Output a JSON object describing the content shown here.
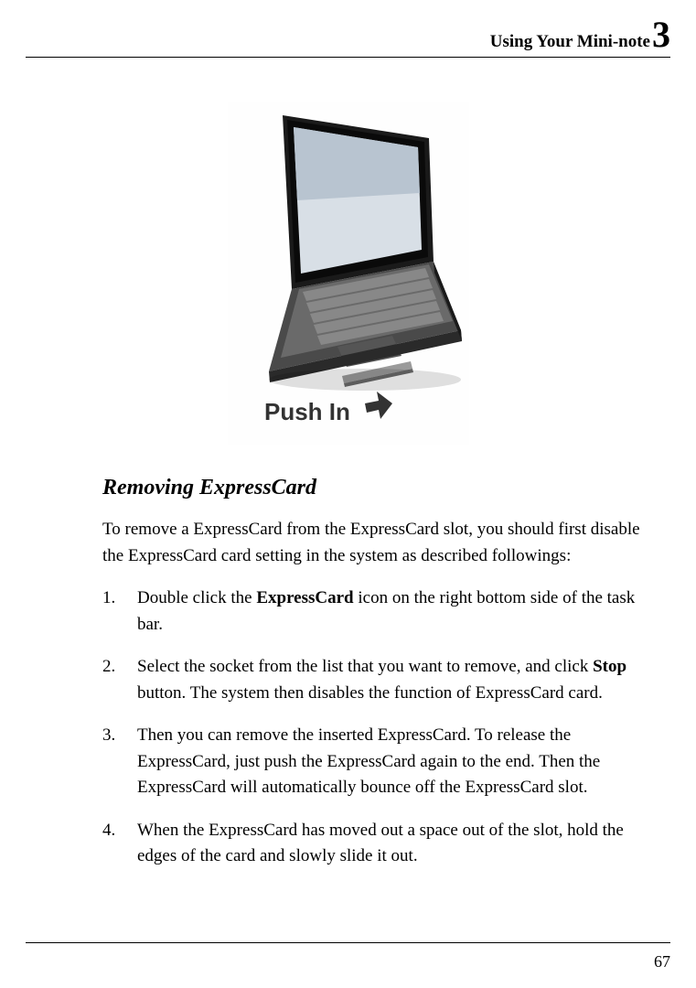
{
  "header": {
    "title": "Using Your Mini-note",
    "chapter": "3"
  },
  "image": {
    "alt": "Mini-note laptop with ExpressCard slot",
    "caption": "Push In"
  },
  "section": {
    "heading": "Removing ExpressCard",
    "intro": "To remove a ExpressCard from the ExpressCard slot, you should first disable the ExpressCard card setting in the system as described followings:",
    "steps": [
      {
        "num": "1.",
        "pre": "Double click the ",
        "bold": "ExpressCard",
        "post": " icon on the right bottom side of the task bar."
      },
      {
        "num": "2.",
        "pre": "Select the socket from the list that you want to remove, and click ",
        "bold": "Stop",
        "post": " button. The system then disables the function of ExpressCard card."
      },
      {
        "num": "3.",
        "pre": "Then you can remove the inserted ExpressCard. To release the ExpressCard, just push the ExpressCard again to the end. Then the ExpressCard will automatically bounce off the ExpressCard slot.",
        "bold": "",
        "post": ""
      },
      {
        "num": "4.",
        "pre": "When the ExpressCard has moved out a space out of the slot, hold the edges of the card and slowly slide it out.",
        "bold": "",
        "post": ""
      }
    ]
  },
  "footer": {
    "page": "67"
  }
}
